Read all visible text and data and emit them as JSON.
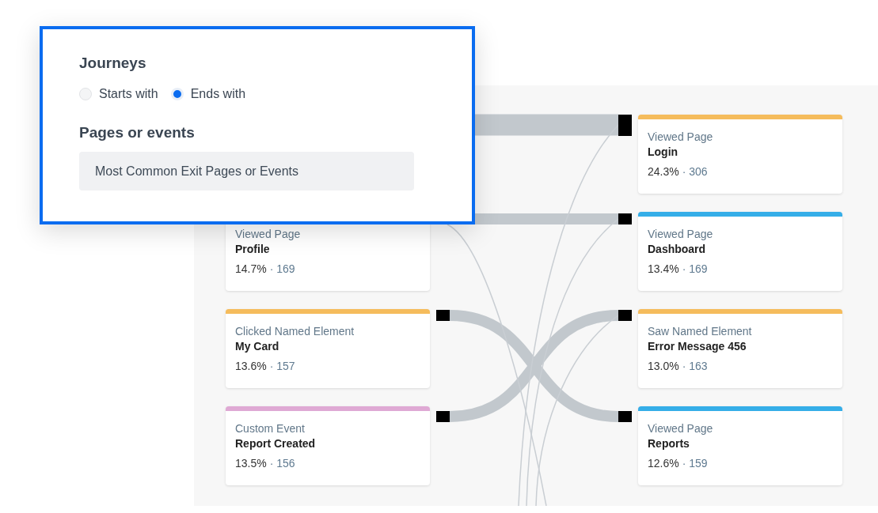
{
  "filter_panel": {
    "title": "Journeys",
    "options": [
      {
        "label": "Starts with",
        "selected": false
      },
      {
        "label": "Ends with",
        "selected": true
      }
    ],
    "field_label": "Pages or events",
    "field": {
      "value": "Most Common Exit Pages or Events"
    }
  },
  "flow": {
    "left_cards": [
      {
        "category": "Viewed Page",
        "name": "Profile",
        "percent": "14.7%",
        "count": "· 169"
      },
      {
        "category": "Clicked Named Element",
        "name": "My Card",
        "percent": "13.6%",
        "count": "· 157",
        "color": "#f5bc5c"
      },
      {
        "category": "Custom Event",
        "name": "Report Created",
        "percent": "13.5%",
        "count": "· 156",
        "color": "#dfa9d4"
      }
    ],
    "right_cards": [
      {
        "category": "Viewed Page",
        "name": "Login",
        "percent": "24.3%",
        "count": "· 306",
        "color": "#f5bc5c"
      },
      {
        "category": "Viewed Page",
        "name": "Dashboard",
        "percent": "13.4%",
        "count": "· 169",
        "color": "#35aee8"
      },
      {
        "category": "Saw Named Element",
        "name": "Error Message 456",
        "percent": "13.0%",
        "count": "· 163",
        "color": "#f5bc5c"
      },
      {
        "category": "Viewed Page",
        "name": "Reports",
        "percent": "12.6%",
        "count": "· 159",
        "color": "#35aee8"
      }
    ]
  }
}
